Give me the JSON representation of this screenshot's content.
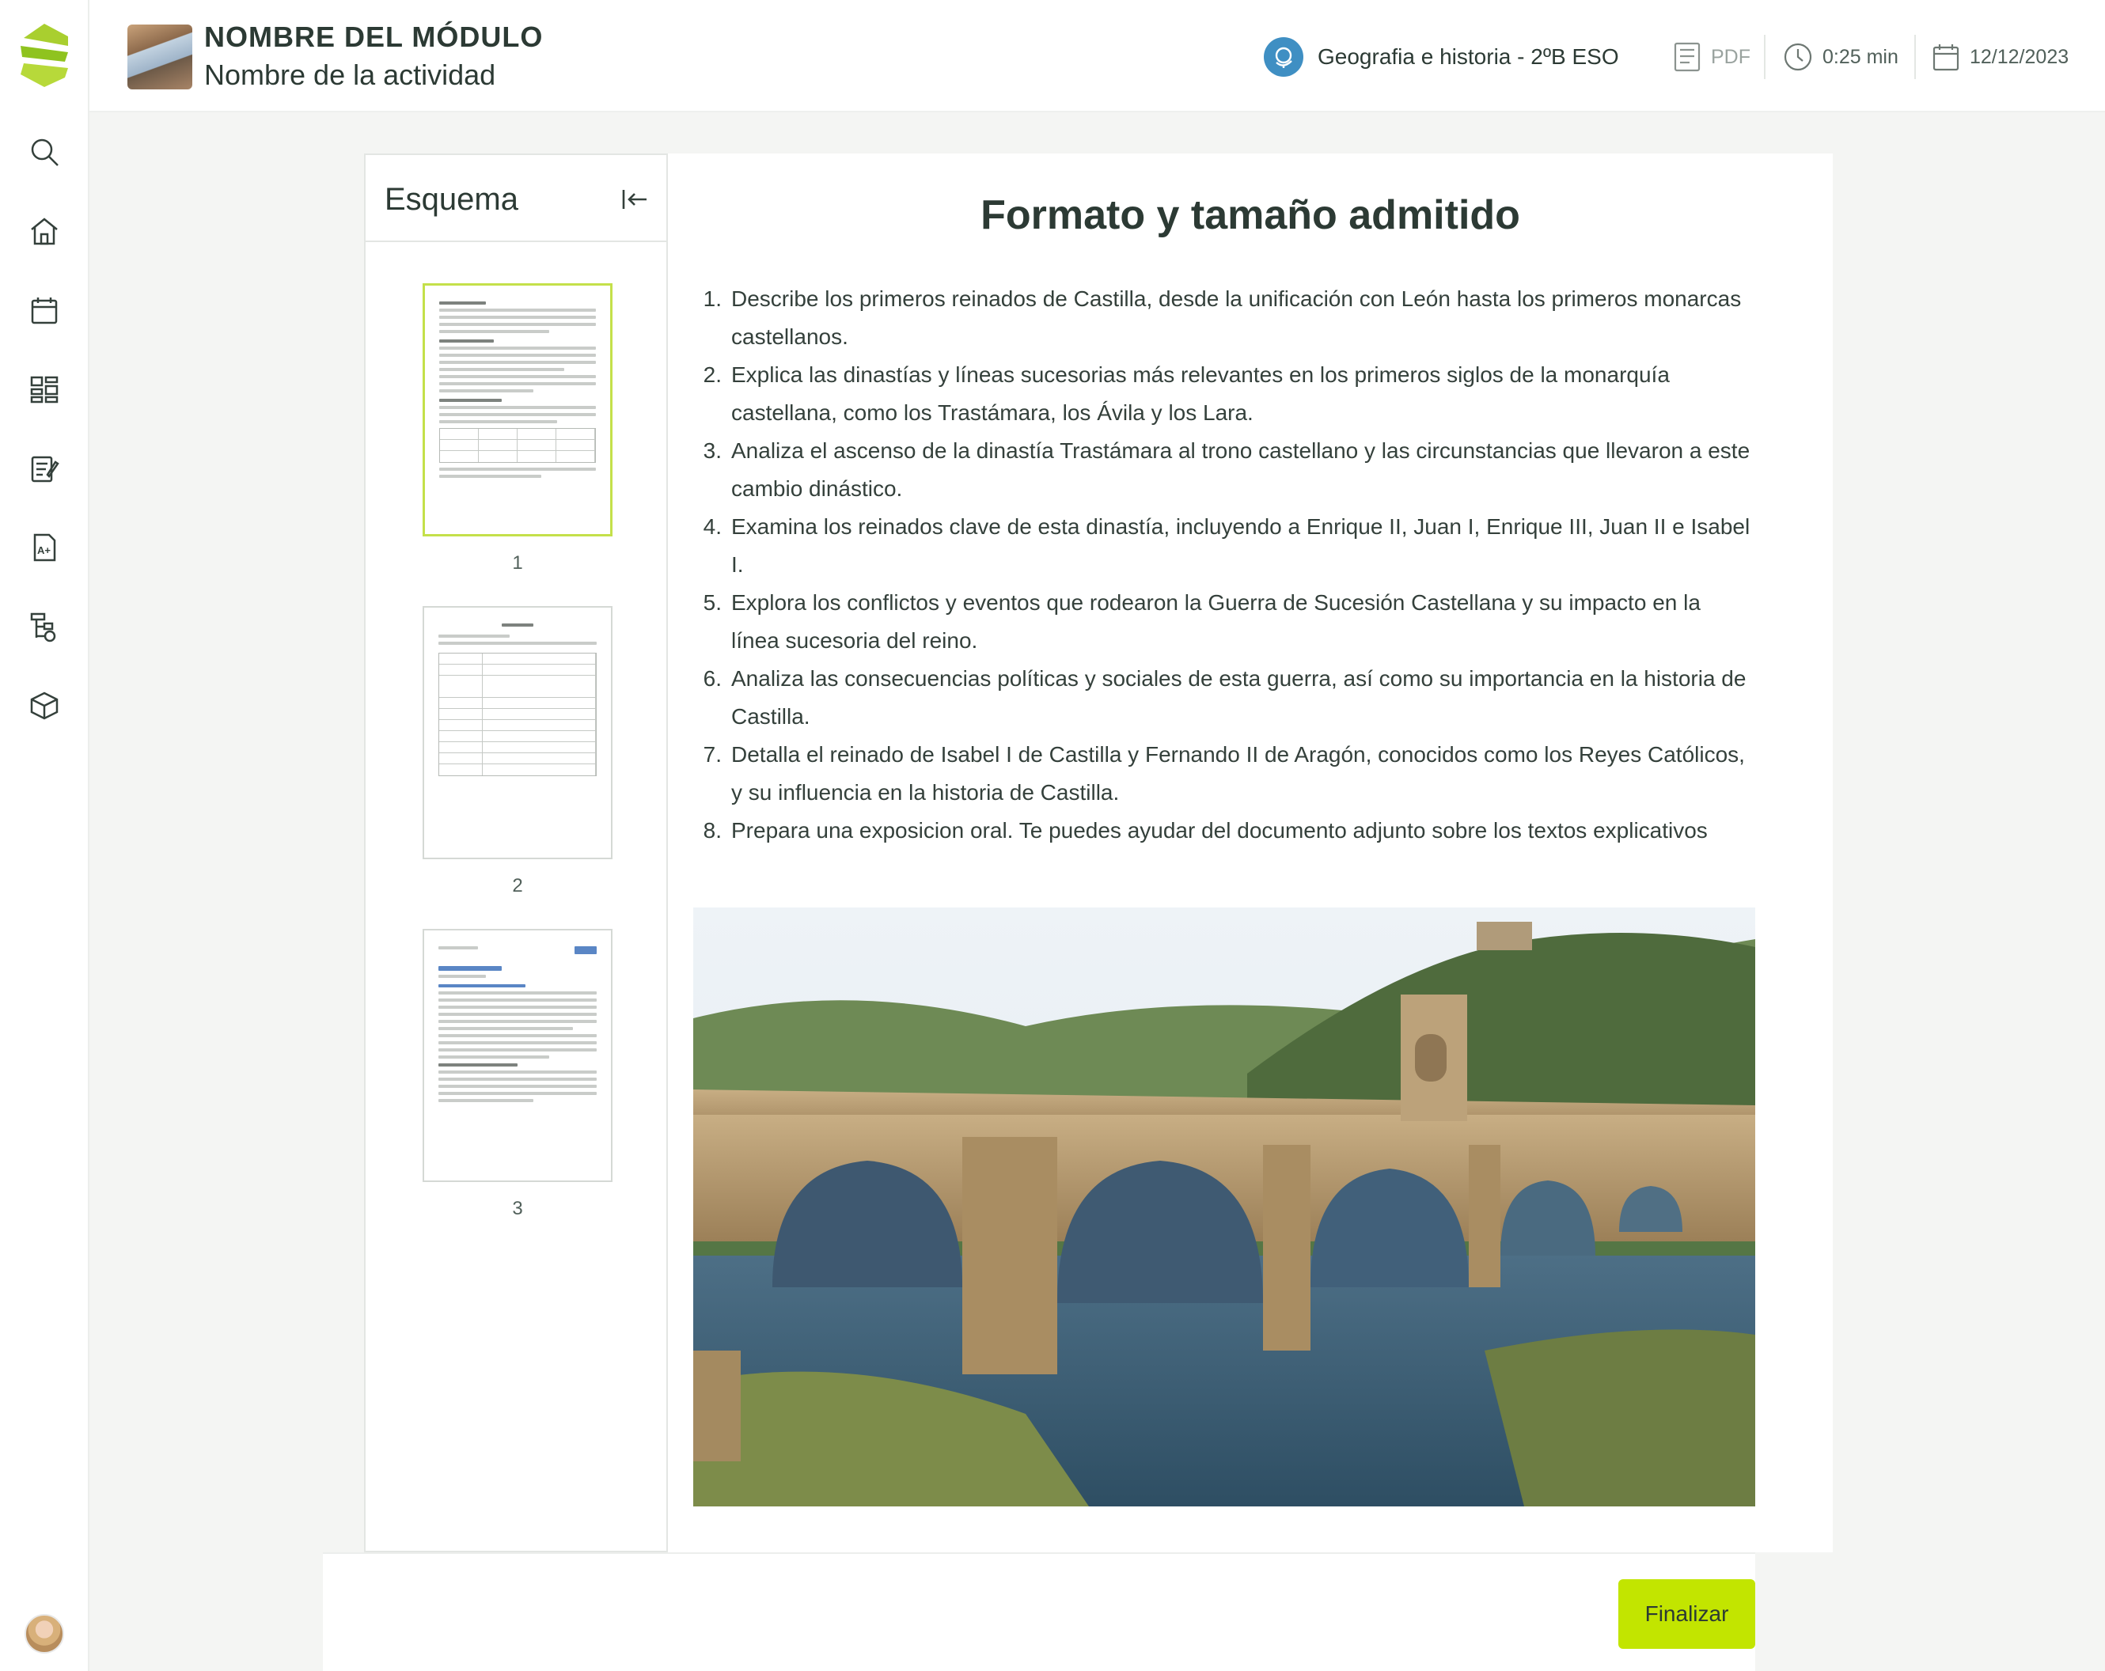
{
  "header": {
    "module_title": "NOMBRE DEL MÓDULO",
    "activity_name": "Nombre de la actividad",
    "subject": "Geografia e historia - 2ºB ESO",
    "pdf_label": "PDF",
    "duration": "0:25 min",
    "date": "12/12/2023"
  },
  "sidebar": {
    "items": [
      {
        "icon": "search-icon"
      },
      {
        "icon": "home-icon"
      },
      {
        "icon": "calendar-icon"
      },
      {
        "icon": "modules-icon"
      },
      {
        "icon": "tasks-icon"
      },
      {
        "icon": "grades-icon"
      },
      {
        "icon": "tree-icon"
      },
      {
        "icon": "box-icon"
      }
    ]
  },
  "outline": {
    "title": "Esquema",
    "pages": [
      {
        "number": "1",
        "active": true
      },
      {
        "number": "2",
        "active": false
      },
      {
        "number": "3",
        "active": false
      }
    ]
  },
  "content": {
    "title": "Formato y tamaño admitido",
    "tasks": [
      {
        "n": "1.",
        "text": "Describe los primeros reinados de Castilla, desde la unificación con León hasta los primeros monarcas castellanos."
      },
      {
        "n": "2.",
        "text": "Explica las dinastías y líneas sucesorias más relevantes en los primeros siglos de la monarquía castellana, como los Trastámara, los Ávila y los Lara."
      },
      {
        "n": "3.",
        "text": "Analiza el ascenso de la dinastía Trastámara al trono castellano y las circunstancias que llevaron a este cambio dinástico."
      },
      {
        "n": "4.",
        "text": "Examina los reinados clave de esta dinastía, incluyendo a Enrique II, Juan I, Enrique III, Juan II e Isabel I."
      },
      {
        "n": "5.",
        "text": "Explora los conflictos y eventos que rodearon la Guerra de Sucesión Castellana y su impacto en la línea sucesoria del reino."
      },
      {
        "n": "6.",
        "text": "Analiza las consecuencias políticas y sociales de esta guerra, así como su importancia en la historia de Castilla."
      },
      {
        "n": "7.",
        "text": "Detalla el reinado de Isabel I de Castilla y Fernando II de Aragón, conocidos como los Reyes Católicos, y su influencia en la historia de Castilla."
      },
      {
        "n": "8.",
        "text": "Prepara una exposicion oral. Te puedes ayudar del documento adjunto sobre los textos explicativos"
      }
    ]
  },
  "footer": {
    "finish_label": "Finalizar"
  },
  "colors": {
    "accent": "#c2e500",
    "subject": "#3f8fc3",
    "text": "#2c3a34"
  }
}
